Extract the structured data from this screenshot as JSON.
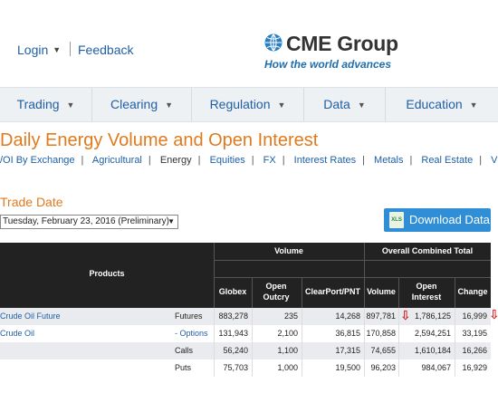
{
  "header": {
    "login": "Login",
    "feedback": "Feedback",
    "logo": "CME Group",
    "tagline": "How the world advances"
  },
  "nav": [
    {
      "label": "Trading"
    },
    {
      "label": "Clearing"
    },
    {
      "label": "Regulation"
    },
    {
      "label": "Data"
    },
    {
      "label": "Education"
    }
  ],
  "page": {
    "title": "Daily Energy Volume and Open Interest",
    "filters": [
      "/OI By Exchange",
      "Agricultural",
      "Energy",
      "Equities",
      "FX",
      "Interest Rates",
      "Metals",
      "Real Estate",
      "V"
    ],
    "active_filter": "Energy",
    "trade_date_label": "Trade Date",
    "trade_date_value": "Tuesday, February 23, 2016 (Preliminary)",
    "download_label": "Download Data",
    "download_icon": "XLS"
  },
  "table": {
    "group_products": "Products",
    "group_volume": "Volume",
    "group_overall": "Overall Combined Total",
    "columns": [
      "Globex",
      "Open Outcry",
      "ClearPort/PNT",
      "Volume",
      "Open Interest",
      "Change"
    ],
    "rows": [
      {
        "product": "Crude Oil Future",
        "type": "Futures",
        "globex": "883,278",
        "outcry": "235",
        "clearport": "14,268",
        "volume": "897,781",
        "oi": "1,786,125",
        "change": "16,999"
      },
      {
        "product": "Crude Oil",
        "type": "- Options",
        "globex": "131,943",
        "outcry": "2,100",
        "clearport": "36,815",
        "volume": "170,858",
        "oi": "2,594,251",
        "change": "33,195"
      },
      {
        "product": "",
        "type": "Calls",
        "globex": "56,240",
        "outcry": "1,100",
        "clearport": "17,315",
        "volume": "74,655",
        "oi": "1,610,184",
        "change": "16,266"
      },
      {
        "product": "",
        "type": "Puts",
        "globex": "75,703",
        "outcry": "1,000",
        "clearport": "19,500",
        "volume": "96,203",
        "oi": "984,067",
        "change": "16,929"
      }
    ]
  },
  "colors": {
    "accent": "#e07a1d",
    "link": "#1f5fa6",
    "header_bg": "#222222",
    "button": "#2f8ed6",
    "arrow": "#d62020"
  }
}
